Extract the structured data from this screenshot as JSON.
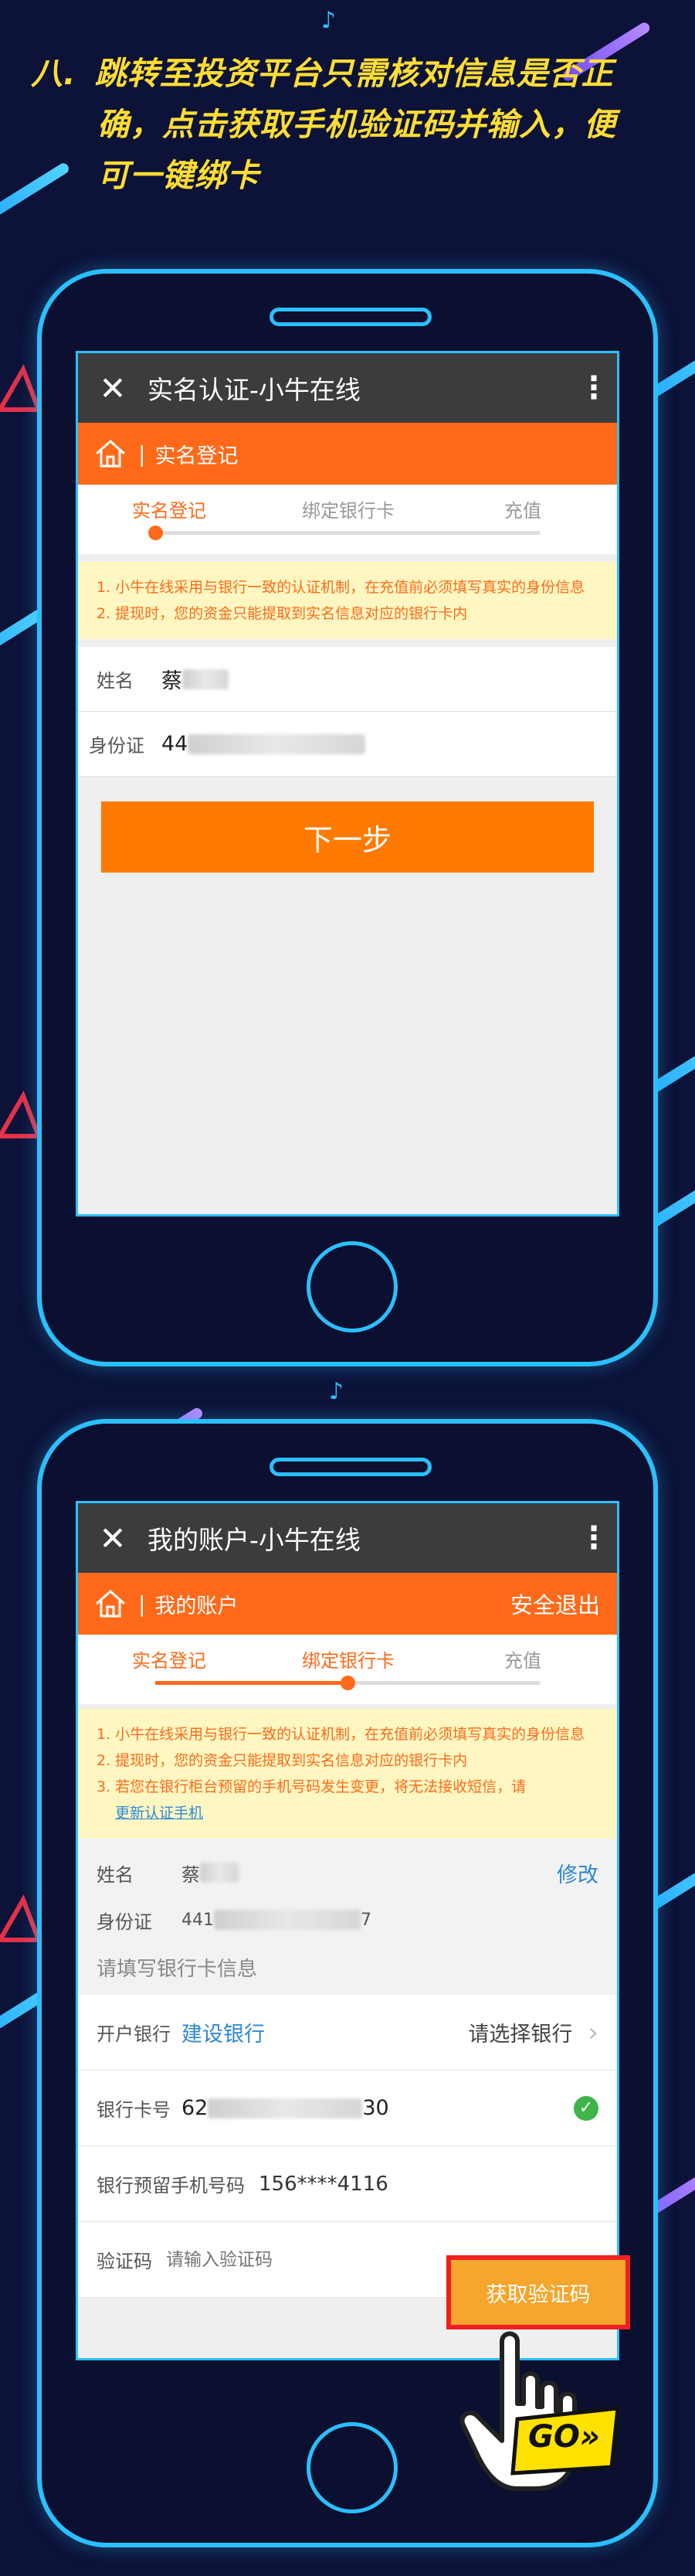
{
  "step_title": {
    "num": "八.",
    "line1": "跳转至投资平台只需核对信息是否正",
    "line2": "确，点击获取手机验证码并输入，便",
    "line3": "可一键绑卡"
  },
  "screen1": {
    "title": "实名认证-小牛在线",
    "breadcrumb": "实名登记",
    "steps": [
      "实名登记",
      "绑定银行卡",
      "充值"
    ],
    "progress": 0.0,
    "notices": [
      "1. 小牛在线采用与银行一致的认证机制，在充值前必须填写真实的身份信息",
      "2. 提现时，您的资金只能提取到实名信息对应的银行卡内"
    ],
    "name_label": "姓名",
    "name_value": "蔡",
    "id_label": "身份证",
    "id_value": "44",
    "next_button": "下一步"
  },
  "screen2": {
    "title": "我的账户-小牛在线",
    "breadcrumb": "我的账户",
    "logout": "安全退出",
    "steps": [
      "实名登记",
      "绑定银行卡",
      "充值"
    ],
    "progress": 0.5,
    "notices": [
      "1. 小牛在线采用与银行一致的认证机制，在充值前必须填写真实的身份信息",
      "2. 提现时，您的资金只能提取到实名信息对应的银行卡内",
      "3. 若您在银行柜台预留的手机号码发生变更，将无法接收短信，请"
    ],
    "notice_link": "更新认证手机",
    "name_label": "姓名",
    "name_value": "蔡",
    "edit_link": "修改",
    "id_label": "身份证",
    "id_prefix": "441",
    "id_suffix": "7",
    "section_title": "请填写银行卡信息",
    "bank_label": "开户银行",
    "bank_value": "建设银行",
    "bank_select": "请选择银行",
    "card_label": "银行卡号",
    "card_prefix": "62",
    "card_suffix": "30",
    "phone_label": "银行预留手机号码",
    "phone_value": "156****4116",
    "code_label": "验证码",
    "code_placeholder": "请输入验证码",
    "sms_button": "获取验证码",
    "go_text": "GO»"
  },
  "colors": {
    "accent": "#ff6a1a",
    "button": "#ff7a00",
    "phone_frame": "#2ac0ff",
    "title": "#ffdd33",
    "link": "#2e88d8"
  }
}
